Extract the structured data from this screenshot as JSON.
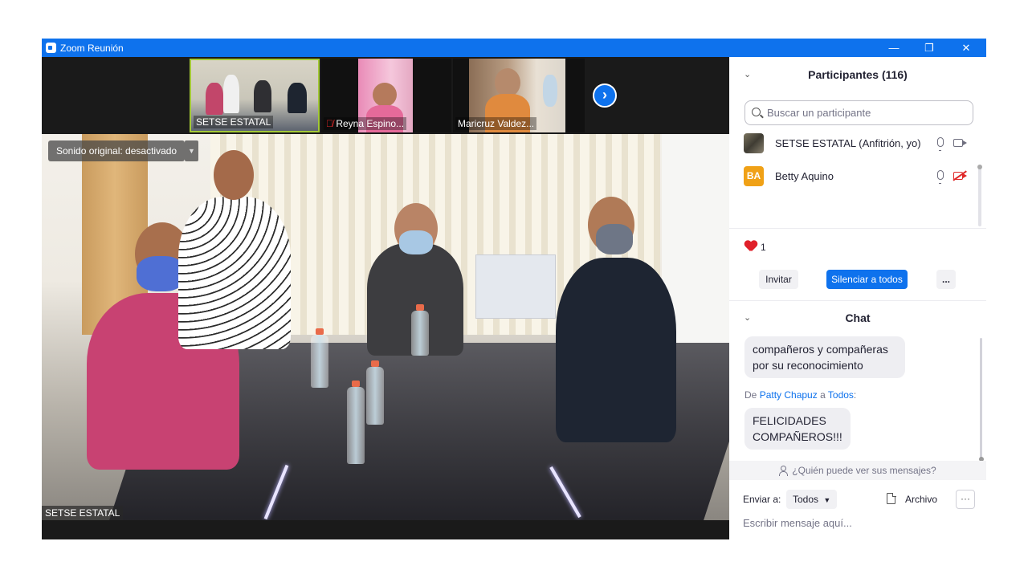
{
  "window": {
    "title": "Zoom Reunión",
    "controls": [
      "—",
      "❐",
      "✕"
    ]
  },
  "thumbnails": [
    {
      "name": "SETSE ESTATAL",
      "muted": false
    },
    {
      "name": "Reyna Espino...",
      "muted": true
    },
    {
      "name": "Maricruz Valdez..."
    }
  ],
  "next_arrow": "›",
  "main_video": {
    "sound_label": "Sonido original: desactivado",
    "sound_dropdown": "▼",
    "speaker_name": "SETSE ESTATAL"
  },
  "participants": {
    "title": "Participantes (116)",
    "collapse": "⌄",
    "search_placeholder": "Buscar un participante",
    "list": [
      {
        "name": "SETSE ESTATAL (Anfitrión, yo)",
        "avatar": "",
        "avatar_color": "#5e5a4c",
        "camera_on": true
      },
      {
        "name": "Betty Aquino",
        "avatar": "BA",
        "avatar_color": "#f0a116",
        "camera_on": false
      }
    ],
    "reactions_count": "1",
    "invite_label": "Invitar",
    "mute_all_label": "Silenciar a todos",
    "more_label": "..."
  },
  "chat": {
    "title": "Chat",
    "collapse": "⌄",
    "message_1": "compañeros y compañeras por su reconocimiento",
    "from_prefix": "De",
    "from_name": "Patty Chapuz",
    "to_word": "a",
    "to_name": "Todos",
    "to_suffix": ":",
    "message_2": "FELICIDADES COMPAÑEROS!!!",
    "who_can_see": "¿Quién puede ver sus mensajes?",
    "send_to_label": "Enviar a:",
    "send_to_value": "Todos",
    "file_label": "Archivo",
    "more_label": "···",
    "input_placeholder": "Escribir mensaje aquí..."
  },
  "colors": {
    "accent": "#0e72ed",
    "title_bar": "#0e72ed",
    "active_speaker_border": "#a3c936",
    "alert_red": "#e02828"
  }
}
